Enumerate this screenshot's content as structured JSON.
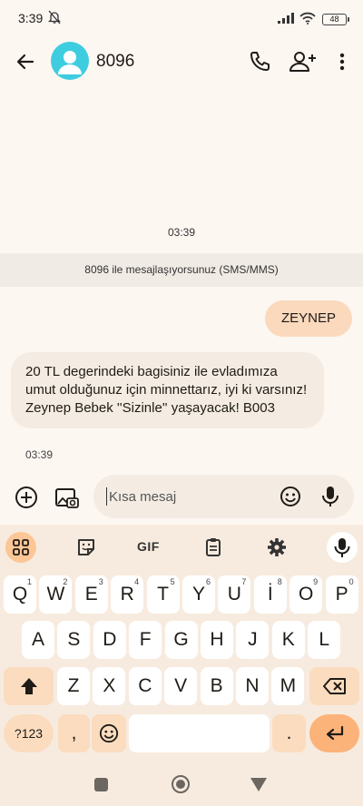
{
  "status": {
    "time": "3:39",
    "battery": "48"
  },
  "header": {
    "contact": "8096"
  },
  "conversation": {
    "date_stamp": "03:39",
    "info_banner": "8096 ile mesajlaşıyorsunuz (SMS/MMS)",
    "outgoing": {
      "text": "ZEYNEP"
    },
    "incoming": {
      "text": "20 TL degerindeki bagisiniz ile evladımıza umut olduğunuz için minnettarız, iyi ki varsınız! Zeynep Bebek ''Sizinle'' yaşayacak! B003",
      "time": "03:39"
    }
  },
  "compose": {
    "placeholder": "Kısa mesaj"
  },
  "keyboard": {
    "toolbar": {
      "gif": "GIF"
    },
    "row1": [
      {
        "k": "Q",
        "s": "1"
      },
      {
        "k": "W",
        "s": "2"
      },
      {
        "k": "E",
        "s": "3"
      },
      {
        "k": "R",
        "s": "4"
      },
      {
        "k": "T",
        "s": "5"
      },
      {
        "k": "Y",
        "s": "6"
      },
      {
        "k": "U",
        "s": "7"
      },
      {
        "k": "İ",
        "s": "8"
      },
      {
        "k": "O",
        "s": "9"
      },
      {
        "k": "P",
        "s": "0"
      }
    ],
    "row2": [
      "A",
      "S",
      "D",
      "F",
      "G",
      "H",
      "J",
      "K",
      "L"
    ],
    "row3": [
      "Z",
      "X",
      "C",
      "V",
      "B",
      "N",
      "M"
    ],
    "sym_label": "?123",
    "comma": ",",
    "period": "."
  },
  "colors": {
    "accent": "#fbb37a",
    "avatar": "#3ecde0",
    "bubble_out": "#fbd9bd",
    "bubble_in": "#f4ece2"
  }
}
